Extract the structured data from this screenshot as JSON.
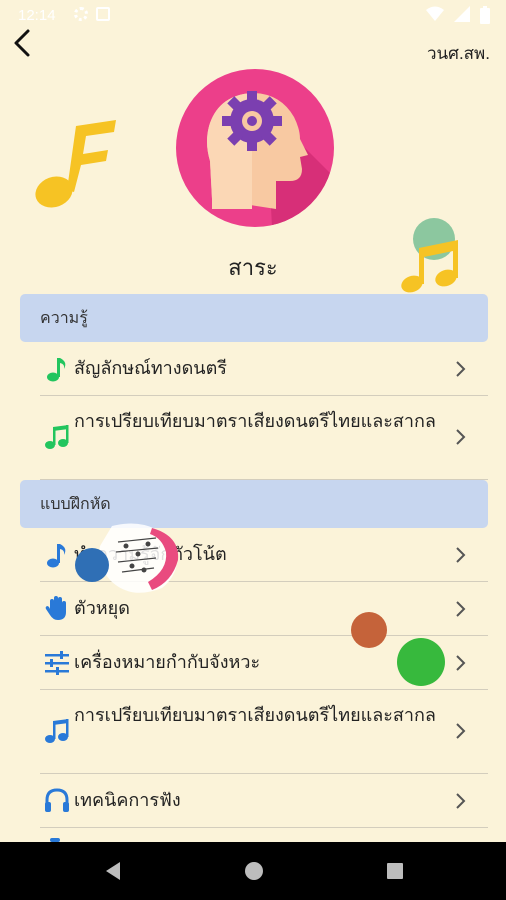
{
  "status_bar": {
    "time": "12:14"
  },
  "header": {
    "org_label": "วนศ.สพ."
  },
  "page_title": "สาระ",
  "sections": [
    {
      "title": "ความรู้"
    },
    {
      "title": "แบบฝึกหัด"
    }
  ],
  "knowledge_items": [
    {
      "label": "สัญลักษณ์ทางดนตรี",
      "icon": "green-eighth-note-icon"
    },
    {
      "label": "การเปรียบเทียบมาตราเสียงดนตรีไทยและสากล",
      "icon": "green-beamed-notes-icon"
    }
  ],
  "exercise_items": [
    {
      "label": "ทำความรู้จักตัวโน้ต",
      "icon": "blue-eighth-note-icon"
    },
    {
      "label": "ตัวหยุด",
      "icon": "hand-icon"
    },
    {
      "label": "เครื่องหมายกำกับจังหวะ",
      "icon": "tune-sliders-icon"
    },
    {
      "label": "การเปรียบเทียบมาตราเสียงดนตรีไทยและสากล",
      "icon": "blue-beamed-notes-icon"
    },
    {
      "label": "เทคนิคการฟัง",
      "icon": "headphones-icon"
    }
  ],
  "colors": {
    "background": "#fbf3d9",
    "section_header": "#c7d6ef",
    "hero_circle": "#ec3f8a",
    "green_icon": "#22c55e",
    "blue_icon": "#2979d8"
  }
}
